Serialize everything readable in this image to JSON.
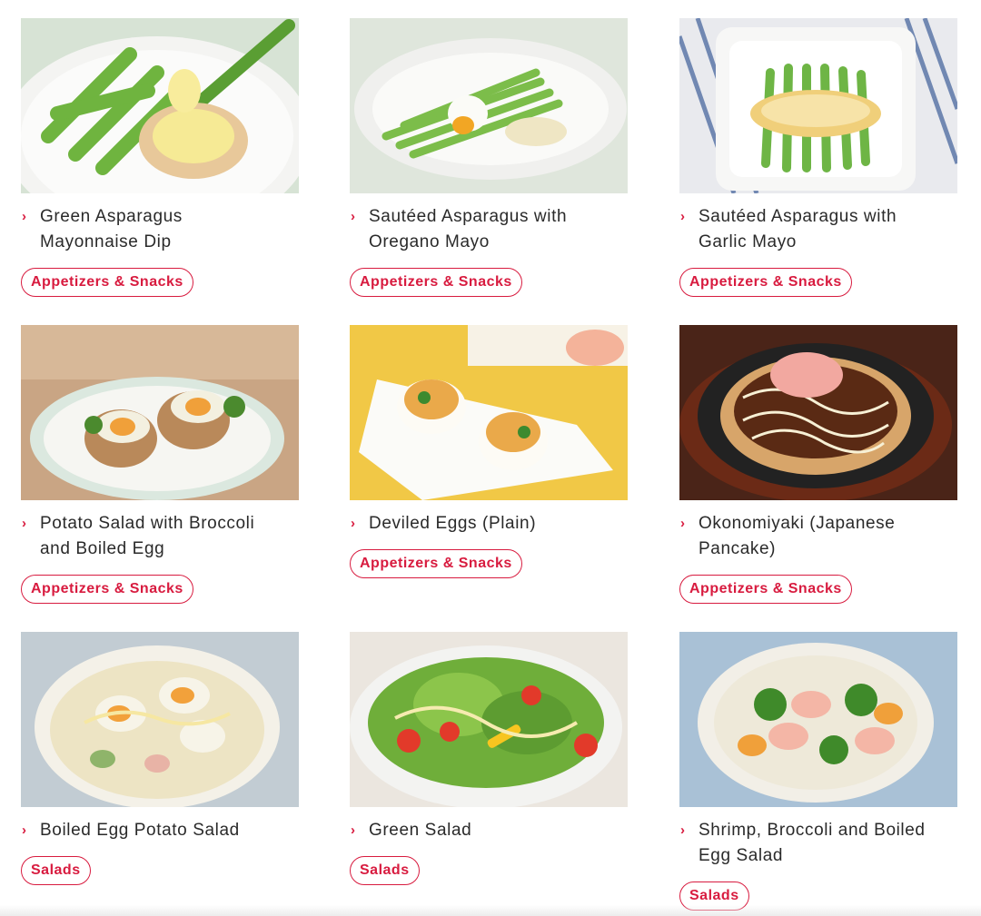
{
  "recipes": [
    {
      "title": "Green Asparagus Mayonnaise Dip",
      "category": "Appetizers & Snacks",
      "image": "asparagus-mayo-dip-photo"
    },
    {
      "title": "Sautéed Asparagus with Oregano Mayo",
      "category": "Appetizers & Snacks",
      "image": "asparagus-oregano-mayo-photo"
    },
    {
      "title": "Sautéed Asparagus with Garlic Mayo",
      "category": "Appetizers & Snacks",
      "image": "asparagus-garlic-mayo-photo"
    },
    {
      "title": "Potato Salad with Broccoli and Boiled Egg",
      "category": "Appetizers & Snacks",
      "image": "potato-salad-broccoli-egg-photo"
    },
    {
      "title": "Deviled Eggs (Plain)",
      "category": "Appetizers & Snacks",
      "image": "deviled-eggs-photo"
    },
    {
      "title": "Okonomiyaki (Japanese Pancake)",
      "category": "Appetizers & Snacks",
      "image": "okonomiyaki-photo"
    },
    {
      "title": "Boiled Egg Potato Salad",
      "category": "Salads",
      "image": "egg-potato-salad-photo"
    },
    {
      "title": "Green Salad",
      "category": "Salads",
      "image": "green-salad-photo"
    },
    {
      "title": "Shrimp, Broccoli and Boiled Egg Salad",
      "category": "Salads",
      "image": "shrimp-broccoli-egg-salad-photo"
    }
  ],
  "colors": {
    "accent": "#d81b3f",
    "text": "#2a2a2a"
  }
}
